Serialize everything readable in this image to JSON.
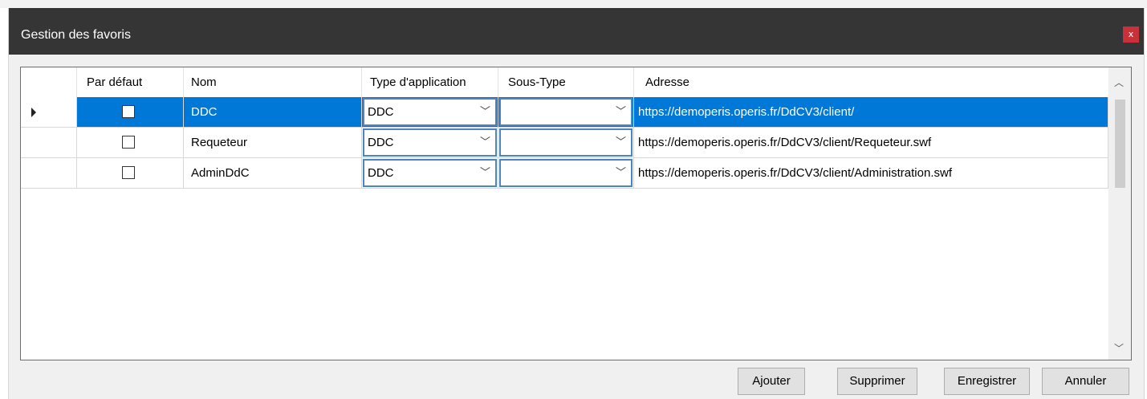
{
  "window": {
    "title": "Gestion des favoris",
    "close_label": "x"
  },
  "grid": {
    "columns": [
      "Par défaut",
      "Nom",
      "Type d'application",
      "Sous-Type",
      "Adresse"
    ],
    "rows": [
      {
        "default": false,
        "nom": "DDC",
        "type": "DDC",
        "sous_type": "",
        "adresse": "https://demoperis.operis.fr/DdCV3/client/",
        "selected": true
      },
      {
        "default": false,
        "nom": "Requeteur",
        "type": "DDC",
        "sous_type": "",
        "adresse": "https://demoperis.operis.fr/DdCV3/client/Requeteur.swf",
        "selected": false
      },
      {
        "default": false,
        "nom": "AdminDdC",
        "type": "DDC",
        "sous_type": "",
        "adresse": "https://demoperis.operis.fr/DdCV3/client/Administration.swf",
        "selected": false
      }
    ]
  },
  "buttons": {
    "add": "Ajouter",
    "delete": "Supprimer",
    "save": "Enregistrer",
    "cancel": "Annuler"
  },
  "colors": {
    "titlebar": "#353535",
    "close": "#c8313a",
    "selection": "#0078d7",
    "combo_border": "#4a86c5"
  },
  "icons": {
    "close": "close-icon",
    "row_pointer": "row-pointer-icon",
    "dropdown": "chevron-down-icon",
    "scroll_up": "chevron-up-icon",
    "scroll_down": "chevron-down-icon"
  }
}
